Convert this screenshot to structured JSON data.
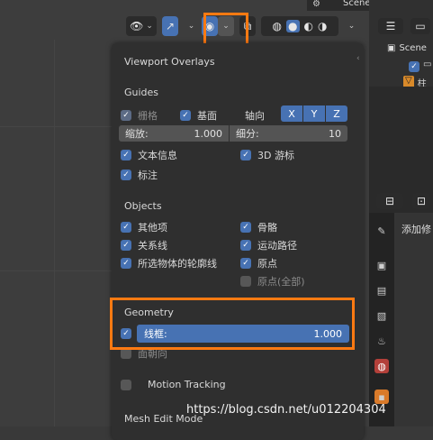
{
  "header": {
    "scene_label": "Scene"
  },
  "toolbar": {
    "icons": [
      "visibility-icon",
      "gizmo-icon",
      "overlays-icon",
      "xray-icon",
      "wireframe-shading-icon",
      "solid-shading-icon",
      "material-shading-icon",
      "rendered-shading-icon"
    ]
  },
  "overlays": {
    "title": "Viewport Overlays",
    "guides": {
      "heading": "Guides",
      "grid_label": "栅格",
      "floor_label": "基面",
      "axis_label": "轴向",
      "axes": [
        "X",
        "Y",
        "Z"
      ],
      "scale_label": "缩放:",
      "scale_value": "1.000",
      "subdiv_label": "细分:",
      "subdiv_value": "10",
      "text_info_label": "文本信息",
      "cursor_label": "3D 游标",
      "annotations_label": "标注"
    },
    "objects": {
      "heading": "Objects",
      "extras_label": "其他项",
      "bones_label": "骨骼",
      "relations_label": "关系线",
      "motion_paths_label": "运动路径",
      "outline_label": "所选物体的轮廓线",
      "origins_label": "原点",
      "origins_all_label": "原点(全部)"
    },
    "geometry": {
      "heading": "Geometry",
      "wireframe_label": "线框:",
      "wireframe_value": "1.000",
      "face_orient_label": "面朝向"
    },
    "motion_tracking_label": "Motion Tracking",
    "mesh_edit_label": "Mesh Edit Mode"
  },
  "outliner": {
    "scene_item": "Scene",
    "object_item": "柱"
  },
  "properties": {
    "add_modifier_label": "添加修"
  },
  "watermark": "https://blog.csdn.net/u012204304",
  "colors": {
    "accent": "#4772b3",
    "highlight": "#ff7a12",
    "panel_bg": "#2f2f2f"
  }
}
